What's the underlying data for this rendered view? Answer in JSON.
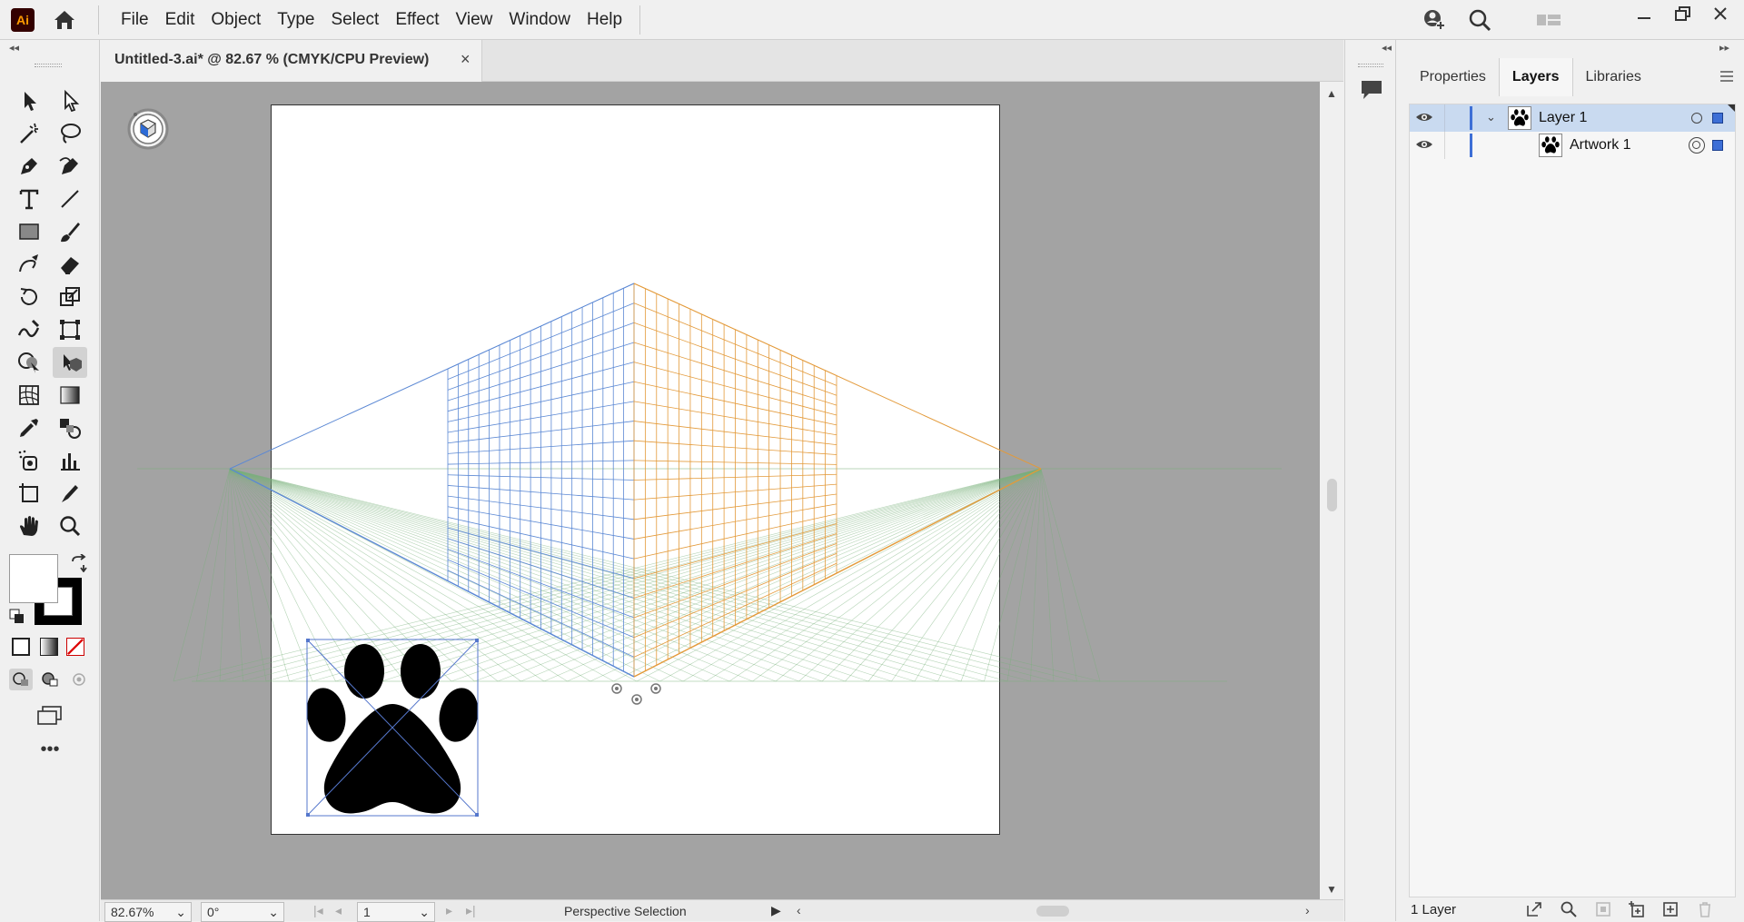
{
  "app": {
    "logo": "Ai"
  },
  "menu": [
    "File",
    "Edit",
    "Object",
    "Type",
    "Select",
    "Effect",
    "View",
    "Window",
    "Help"
  ],
  "document": {
    "tab_title": "Untitled-3.ai* @ 82.67 % (CMYK/CPU Preview)",
    "close": "×"
  },
  "status": {
    "zoom": "82.67%",
    "rotation": "0°",
    "artboard": "1",
    "tool_label": "Perspective Selection"
  },
  "panel": {
    "tabs": [
      "Properties",
      "Layers",
      "Libraries"
    ],
    "active_tab": "Layers",
    "layers": [
      {
        "name": "Layer 1",
        "level": 0,
        "expanded": true,
        "selected": true
      },
      {
        "name": "Artwork 1",
        "level": 1,
        "expanded": false,
        "selected": false
      }
    ],
    "footer_count": "1 Layer"
  },
  "colors": {
    "accent": "#3d6fd6",
    "orange_grid": "#e39a3a",
    "blue_grid": "#5b88d4",
    "green_grid": "#79b07a",
    "selection": "#c9daf0"
  },
  "icons": {
    "tools": [
      "selection-arrow",
      "direct-selection-arrow",
      "magic-wand",
      "lasso",
      "pen",
      "curvature-pen",
      "type",
      "line",
      "rectangle",
      "paintbrush",
      "shaper",
      "eraser",
      "rotate",
      "scale",
      "warp",
      "free-transform",
      "shape-builder",
      "perspective-selection",
      "mesh",
      "gradient",
      "eyedropper",
      "blend",
      "symbol-sprayer",
      "graph",
      "artboard",
      "slice",
      "hand",
      "zoom"
    ]
  }
}
